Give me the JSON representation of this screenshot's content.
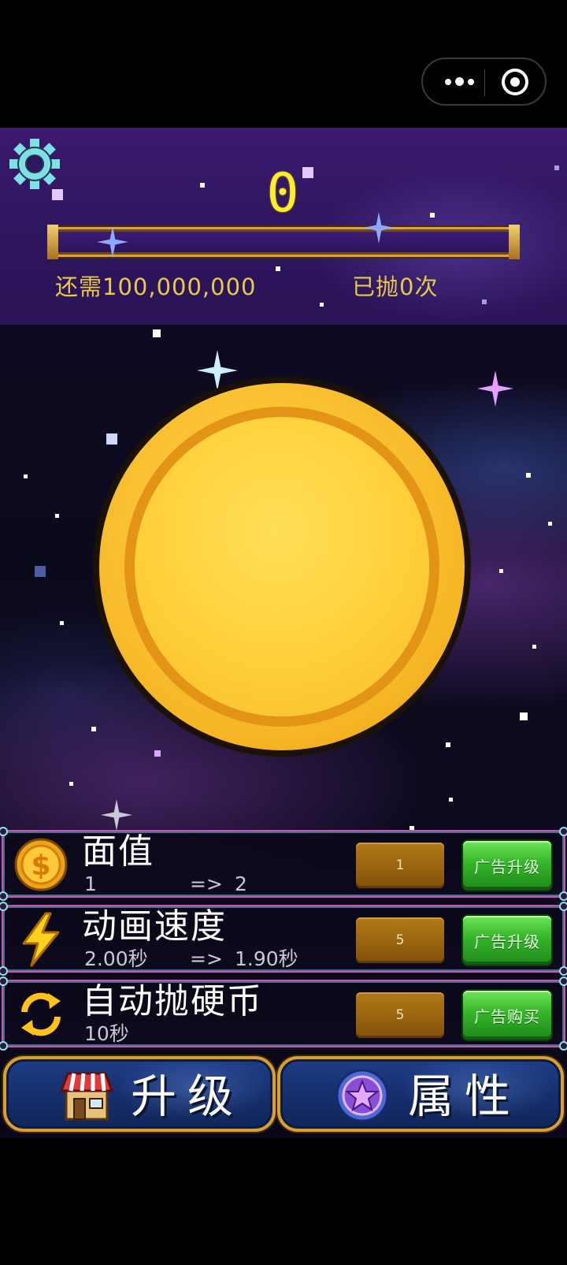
{
  "hud": {
    "score": "0",
    "need_text": "还需100,000,000",
    "thrown_text": "已抛0次",
    "progress": 0
  },
  "upgrades": [
    {
      "title": "面值",
      "current": "1",
      "arrow": "=>",
      "next": "2",
      "cost": "1",
      "ad_label": "广告升级",
      "icon": "dollar-coin-icon"
    },
    {
      "title": "动画速度",
      "current": "2.00秒",
      "arrow": "=>",
      "next": "1.90秒",
      "cost": "5",
      "ad_label": "广告升级",
      "icon": "lightning-icon"
    },
    {
      "title": "自动抛硬币",
      "current": "10秒",
      "arrow": "",
      "next": "",
      "cost": "5",
      "ad_label": "广告购买",
      "icon": "refresh-cycle-icon"
    }
  ],
  "nav": {
    "upgrade_label": "升级",
    "attributes_label": "属性"
  },
  "colors": {
    "score_yellow": "#ffef2a",
    "text_gold": "#e8c94a",
    "ad_green": "#34b52a",
    "cost_bronze": "#9a6410",
    "frame_gold": "#d8a02e"
  }
}
